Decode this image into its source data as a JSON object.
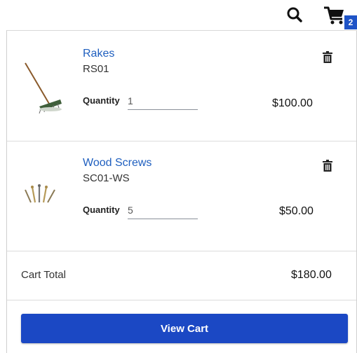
{
  "header": {
    "search_icon": "search-icon",
    "cart_icon": "cart-icon",
    "cart_count": "2",
    "badge_color": "#1f54c7"
  },
  "cart": {
    "items": [
      {
        "name": "Rakes",
        "sku": "RS01",
        "quantity_label": "Quantity",
        "quantity": "1",
        "price": "$100.00",
        "image_icon": "rake-icon",
        "delete_icon": "trash-icon"
      },
      {
        "name": "Wood Screws",
        "sku": "SC01-WS",
        "quantity_label": "Quantity",
        "quantity": "5",
        "price": "$50.00",
        "image_icon": "screws-icon",
        "delete_icon": "trash-icon"
      }
    ],
    "total_label": "Cart Total",
    "total_value": "$180.00",
    "view_cart_label": "View Cart"
  },
  "colors": {
    "link": "#1f5fbf",
    "primary_button": "#1b48c4"
  }
}
